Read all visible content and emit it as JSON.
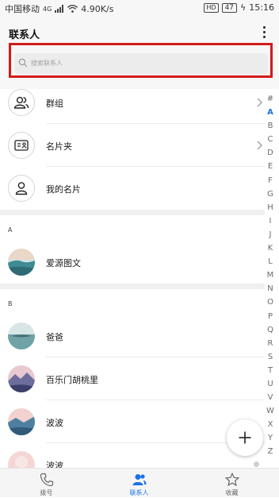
{
  "status_bar": {
    "carrier": "中国移动",
    "network": "4G",
    "speed": "4.90K/s",
    "hd": "HD",
    "battery": "47",
    "time": "15:16"
  },
  "app_bar": {
    "title": "联系人",
    "more_icon": "more-vertical-icon"
  },
  "search": {
    "placeholder": "搜索联系人",
    "icon": "search-icon",
    "highlight_color": "#d31a1a"
  },
  "top_items": [
    {
      "label": "群组",
      "icon": "group-icon",
      "has_chevron": true
    },
    {
      "label": "名片夹",
      "icon": "card-holder-icon",
      "has_chevron": true
    },
    {
      "label": "我的名片",
      "icon": "person-icon",
      "has_chevron": false
    }
  ],
  "sections": [
    {
      "letter": "A",
      "contacts": [
        "爱源图文"
      ]
    },
    {
      "letter": "B",
      "contacts": [
        "爸爸",
        "百乐门胡桃里",
        "波波",
        "波波"
      ]
    }
  ],
  "alphabet_index": {
    "letters": [
      "#",
      "A",
      "B",
      "C",
      "D",
      "E",
      "F",
      "G",
      "H",
      "I",
      "J",
      "K",
      "L",
      "M",
      "N",
      "O",
      "P",
      "Q",
      "R",
      "S",
      "T",
      "U",
      "V",
      "W",
      "X",
      "Y",
      "Z"
    ],
    "active": "A"
  },
  "fab": {
    "icon": "add-icon"
  },
  "bottom_nav": {
    "items": [
      {
        "label": "拨号",
        "icon": "phone-icon"
      },
      {
        "label": "联系人",
        "icon": "contacts-icon"
      },
      {
        "label": "收藏",
        "icon": "star-icon"
      }
    ],
    "active": "联系人"
  },
  "colors": {
    "accent": "#1a73e8",
    "background": "#ffffff",
    "header": "#f7f7f7"
  }
}
